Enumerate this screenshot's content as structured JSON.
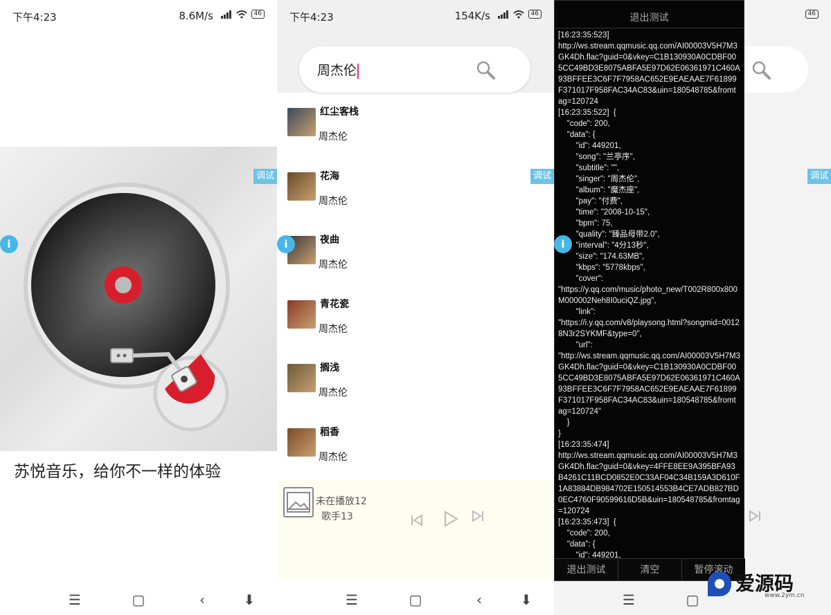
{
  "panel1": {
    "status": {
      "time": "下午4:23",
      "speed": "8.6M/s",
      "battery": "46"
    },
    "debug_label": "调试",
    "slogan": "苏悦音乐，给你不一样的体验"
  },
  "panel2": {
    "status": {
      "time": "下午4:23",
      "speed": "154K/s",
      "battery": "46"
    },
    "search": {
      "value": "周杰伦"
    },
    "debug_label": "调试",
    "songs": [
      {
        "title": "红尘客栈",
        "artist": "周杰伦",
        "cover_color": "#3a4a5a"
      },
      {
        "title": "花海",
        "artist": "周杰伦",
        "cover_color": "#6a4a2a"
      },
      {
        "title": "夜曲",
        "artist": "周杰伦",
        "cover_color": "#3a3a3a"
      },
      {
        "title": "青花瓷",
        "artist": "周杰伦",
        "cover_color": "#8a3a2a"
      },
      {
        "title": "搁浅",
        "artist": "周杰伦",
        "cover_color": "#6a5a3a"
      },
      {
        "title": "稻香",
        "artist": "周杰伦",
        "cover_color": "#7a4a2a"
      }
    ],
    "player": {
      "title": "未在播放12",
      "artist": "歌手13"
    }
  },
  "panel3": {
    "status": {
      "battery": "46"
    },
    "debug_label": "调试",
    "log": {
      "top_button": "退出测试",
      "text": "[16:23:35:523]\nhttp://ws.stream.qqmusic.qq.com/AI00003V5H7M3GK4Dh.flac?guid=0&vkey=C1B130930A0CDBF005CC49BD3E8075ABFA5E97D62E06361971C460A93BFFEE3C6F7F7958AC652E9EAEAAE7F61899F371017F958FAC34AC83&uin=180548785&fromtag=120724\n[16:23:35:522]  {\n    \"code\": 200,\n    \"data\": {\n        \"id\": 449201,\n        \"song\": \"兰亭序\",\n        \"subtitle\": \"\",\n        \"singer\": \"周杰伦\",\n        \"album\": \"魔杰座\",\n        \"pay\": \"付费\",\n        \"time\": \"2008-10-15\",\n        \"bpm\": 75,\n        \"quality\": \"臻品母带2.0\",\n        \"interval\": \"4分13秒\",\n        \"size\": \"174.63MB\",\n        \"kbps\": \"5778kbps\",\n        \"cover\":\n\"https://y.qq.com/music/photo_new/T002R800x800M000002Neh8I0uciQZ.jpg\",\n        \"link\":\n\"https://i.y.qq.com/v8/playsong.html?songmid=00128N3r2SYKMF&type=0\",\n        \"url\":\n\"http://ws.stream.qqmusic.qq.com/AI00003V5H7M3GK4Dh.flac?guid=0&vkey=C1B130930A0CDBF005CC49BD3E8075ABFA5E97D62E06361971C460A93BFFEE3C6F7F7958AC652E9EAEAAE7F61899F371017F958FAC34AC83&uin=180548785&fromtag=120724\"\n    }\n}\n[16:23:35:474]\nhttp://ws.stream.qqmusic.qq.com/AI00003V5H7M3GK4Dh.flac?guid=0&vkey=4FFE8EE9A395BFA93B4261C11BCD0852E0C33AF04C34B159A3D610F1A83884DB984702E150514553B4CE7ADB827BD0EC4760F90599616D5B&uin=180548785&fromtag=120724\n[16:23:35:473]  {\n    \"code\": 200,\n    \"data\": {\n        \"id\": 449201,",
      "buttons": [
        "退出测试",
        "清空",
        "暂停滚动"
      ]
    }
  },
  "watermark": {
    "text": "爱源码",
    "url": "www.2ym.cn"
  }
}
